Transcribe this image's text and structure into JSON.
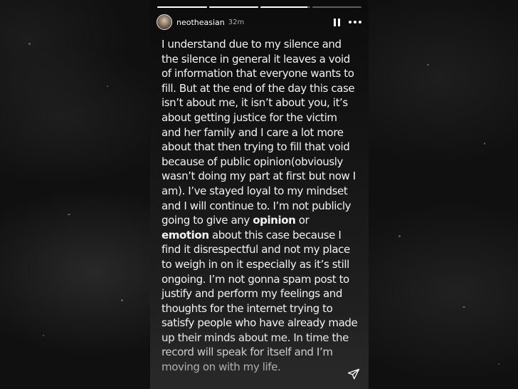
{
  "story": {
    "username": "neotheasian",
    "time_ago": "32m",
    "progress_segments": [
      1,
      1,
      0.95,
      0
    ],
    "text_parts": [
      "I understand due to my silence and the silence in general it leaves a void of information that everyone wants to fill. But at the end of the day this case isn’t about me, it isn’t about you, it’s about getting justice for the victim and her family and I care a lot more about that then trying to fill that void because of public opinion(obviously wasn’t doing my part at first but now I am). I’ve stayed loyal to my mindset and I will continue to. I’m not publicly going to give any ",
      "opinion",
      " or ",
      "emotion",
      " about this case because I find it disrespectful and not my place to weigh in on it especially as it’s still ongoing. I’m not gonna spam post to justify and perform my feelings and thoughts for the internet trying to satisfy people who have already made up their minds about me. In time the record will speak for itself and I’m moving on with my life."
    ]
  },
  "icons": {
    "avatar": "profile-avatar",
    "pause": "pause-icon",
    "more": "more-icon",
    "send": "send-icon"
  },
  "colors": {
    "background": "#101010",
    "text": "#f2f2f2"
  }
}
